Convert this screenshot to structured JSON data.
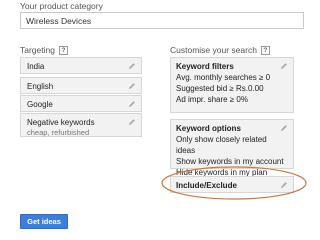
{
  "product": {
    "label": "Your product category",
    "value": "Wireless Devices"
  },
  "targeting": {
    "label": "Targeting",
    "help": "?",
    "items": [
      {
        "label": "India"
      },
      {
        "label": "English"
      },
      {
        "label": "Google"
      },
      {
        "label": "Negative keywords",
        "sub": "cheap, refurbished"
      }
    ]
  },
  "customise": {
    "label": "Customise your search",
    "help": "?",
    "filters": {
      "title": "Keyword filters",
      "lines": [
        "Avg. monthly searches ≥ 0",
        "Suggested bid ≥ Rs.0.00",
        "Ad impr. share ≥ 0%"
      ]
    },
    "options": {
      "title": "Keyword options",
      "lines": [
        "Only show closely related ideas",
        "Show keywords in my account",
        "Hide keywords in my plan"
      ]
    },
    "include": {
      "title": "Include/Exclude"
    }
  },
  "actions": {
    "get_ideas": "Get ideas"
  },
  "colors": {
    "accent": "#3a7fe0",
    "highlight": "#c8793c"
  },
  "icons": {
    "edit": "pencil-icon",
    "help": "help-icon"
  }
}
